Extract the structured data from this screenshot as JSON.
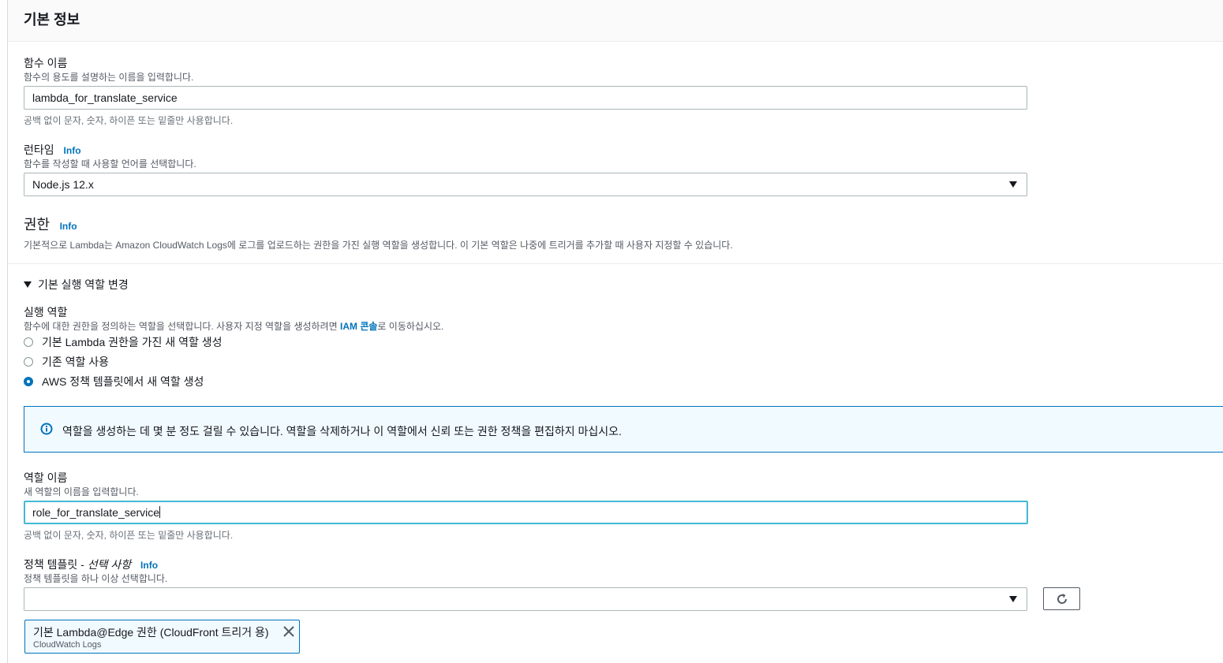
{
  "section": {
    "title": "기본 정보"
  },
  "function_name": {
    "label": "함수 이름",
    "description": "함수의 용도를 설명하는 이름을 입력합니다.",
    "value": "lambda_for_translate_service",
    "constraint": "공백 없이 문자, 숫자, 하이픈 또는 밑줄만 사용합니다."
  },
  "runtime": {
    "label": "런타임",
    "info": "Info",
    "description": "함수를 작성할 때 사용할 언어를 선택합니다.",
    "value": "Node.js 12.x"
  },
  "permissions": {
    "label": "권한",
    "info": "Info",
    "description": "기본적으로 Lambda는 Amazon CloudWatch Logs에 로그를 업로드하는 권한을 가진 실행 역할을 생성합니다. 이 기본 역할은 나중에 트리거를 추가할 때 사용자 지정할 수 있습니다."
  },
  "execution_role": {
    "toggle_label": "기본 실행 역할 변경",
    "label": "실행 역할",
    "description_prefix": "함수에 대한 권한을 정의하는 역할을 선택합니다. 사용자 지정 역할을 생성하려면 ",
    "description_link": "IAM 콘솔",
    "description_suffix": "로 이동하십시오.",
    "options": [
      {
        "label": "기본 Lambda 권한을 가진 새 역할 생성",
        "checked": false
      },
      {
        "label": "기존 역할 사용",
        "checked": false
      },
      {
        "label": "AWS 정책 템플릿에서 새 역할 생성",
        "checked": true
      }
    ]
  },
  "alert": {
    "icon": "info-circle-icon",
    "text": "역할을 생성하는 데 몇 분 정도 걸릴 수 있습니다. 역할을 삭제하거나 이 역할에서 신뢰 또는 권한 정책을 편집하지 마십시오."
  },
  "role_name": {
    "label": "역할 이름",
    "description": "새 역할의 이름을 입력합니다.",
    "value": "role_for_translate_service",
    "constraint": "공백 없이 문자, 숫자, 하이픈 또는 밑줄만 사용합니다."
  },
  "policy_templates": {
    "label": "정책 템플릿 - ",
    "label_optional": "선택 사항",
    "info": "Info",
    "description": "정책 템플릿을 하나 이상 선택합니다.",
    "value": "",
    "selected_token": {
      "label": "기본 Lambda@Edge 권한 (CloudFront 트리거 용)",
      "sublabel": "CloudWatch Logs"
    }
  },
  "colors": {
    "link": "#0073bb",
    "focus": "#44b9d6",
    "alert_bg": "#f1faff"
  }
}
